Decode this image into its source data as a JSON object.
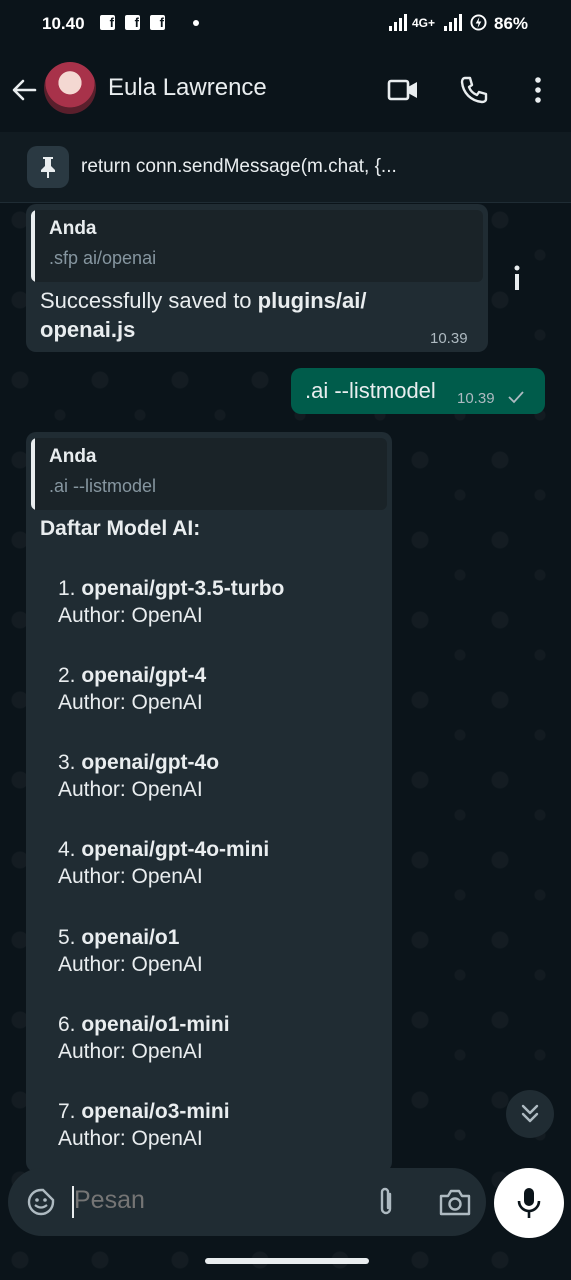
{
  "status_bar": {
    "time": "10.40",
    "network": "4G+",
    "battery": "86%"
  },
  "header": {
    "contact_name": "Eula Lawrence"
  },
  "pinned": {
    "text": "return conn.sendMessage(m.chat, {..."
  },
  "messages": {
    "m1": {
      "quote_author": "Anda",
      "quote_text": ".sfp ai/openai",
      "text_prefix": "Successfully saved to ",
      "text_bold_1": "plugins/ai/",
      "text_bold_2": "openai.js",
      "time": "10.39"
    },
    "m2": {
      "text": ".ai --listmodel",
      "time": "10.39"
    },
    "m3": {
      "quote_author": "Anda",
      "quote_text": ".ai --listmodel",
      "heading": "Daftar Model AI:",
      "models": [
        {
          "num": "1.",
          "name": "openai/gpt-3.5-turbo",
          "author": "Author: OpenAI"
        },
        {
          "num": "2.",
          "name": "openai/gpt-4",
          "author": "Author: OpenAI"
        },
        {
          "num": "3.",
          "name": "openai/gpt-4o",
          "author": "Author: OpenAI"
        },
        {
          "num": "4.",
          "name": "openai/gpt-4o-mini",
          "author": "Author: OpenAI"
        },
        {
          "num": "5.",
          "name": "openai/o1",
          "author": "Author: OpenAI"
        },
        {
          "num": "6.",
          "name": "openai/o1-mini",
          "author": "Author: OpenAI"
        },
        {
          "num": "7.",
          "name": "openai/o3-mini",
          "author": "Author: OpenAI"
        }
      ]
    }
  },
  "input": {
    "placeholder": "Pesan"
  },
  "colors": {
    "bubble_in": "#202c33",
    "bubble_out": "#005c4b",
    "background": "#0b141a"
  }
}
